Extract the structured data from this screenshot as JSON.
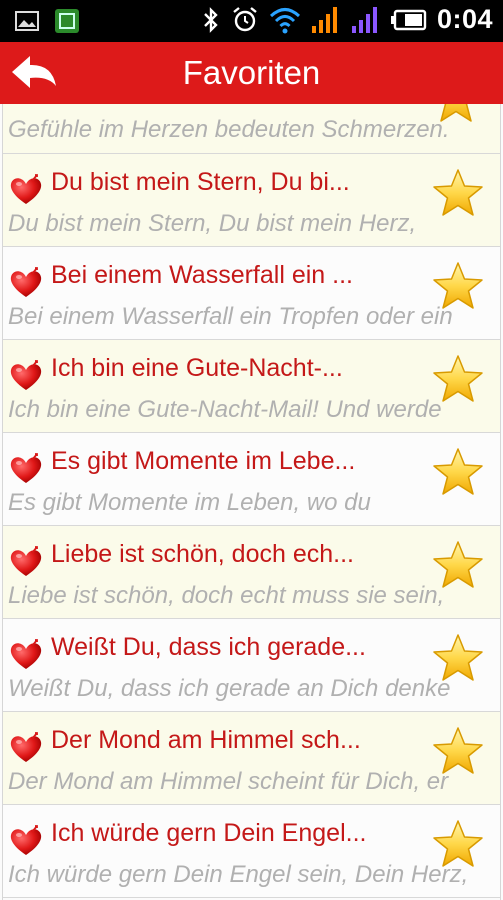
{
  "status_bar": {
    "time": "0:04",
    "colors": {
      "background": "#000000",
      "wifi": "#2aa3ff",
      "signal1": "#ff8a00",
      "signal2": "#8b57ff"
    },
    "icons": [
      "image-icon",
      "app-notification-icon",
      "bluetooth-icon",
      "alarm-icon",
      "wifi-icon",
      "signal-icon",
      "signal-icon",
      "battery-icon"
    ]
  },
  "app_bar": {
    "title": "Favoriten",
    "back_icon": "back-arrow-icon",
    "color": "#dd1a1a"
  },
  "partial_item": {
    "preview": "Gefühle im Herzen bedeuten Schmerzen."
  },
  "items": [
    {
      "title": "Du bist mein Stern, Du bi...",
      "preview": "Du bist mein Stern, Du bist mein Herz,"
    },
    {
      "title": "Bei einem Wasserfall ein ...",
      "preview": "Bei einem Wasserfall ein Tropfen oder ein"
    },
    {
      "title": "Ich bin eine Gute-Nacht-...",
      "preview": "Ich bin eine Gute-Nacht-Mail! Und werde"
    },
    {
      "title": "Es gibt Momente im Lebe...",
      "preview": "Es gibt Momente im Leben, wo du"
    },
    {
      "title": "Liebe ist schön, doch ech...",
      "preview": "Liebe ist schön, doch echt muss sie sein,"
    },
    {
      "title": "Weißt Du, dass ich gerade...",
      "preview": "Weißt Du, dass ich gerade an Dich denke"
    },
    {
      "title": "Der Mond am Himmel sch...",
      "preview": "Der Mond am Himmel scheint für Dich, er"
    },
    {
      "title": "Ich würde gern Dein Engel...",
      "preview": "Ich würde gern Dein Engel sein, Dein Herz,"
    }
  ]
}
